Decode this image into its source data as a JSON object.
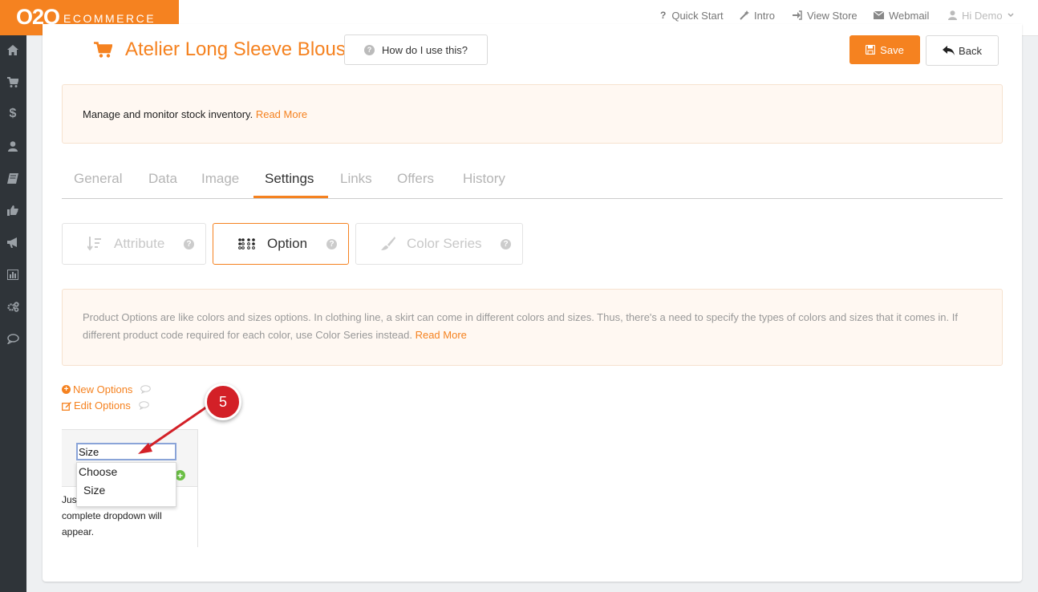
{
  "brand": {
    "o2o": "O2O",
    "ecommerce": "ECOMMERCE",
    "color": "#f58220"
  },
  "topnav": {
    "quick_start": "Quick Start",
    "intro": "Intro",
    "view_store": "View Store",
    "webmail": "Webmail",
    "user": "Hi Demo"
  },
  "sidebar": {
    "items": [
      "home-icon",
      "cart-icon",
      "dollar-icon",
      "user-icon",
      "book-icon",
      "thumbs-up-icon",
      "bullhorn-icon",
      "bar-chart-icon",
      "gears-icon",
      "comment-icon"
    ]
  },
  "header": {
    "title": "Atelier Long Sleeve Blouse",
    "help": "How do I use this?",
    "save": "Save",
    "back": "Back"
  },
  "info": {
    "text": "Manage and monitor stock inventory.",
    "link": "Read More"
  },
  "tabs": [
    "General",
    "Data",
    "Image",
    "Settings",
    "Links",
    "Offers",
    "History"
  ],
  "active_tab": "Settings",
  "subtabs": {
    "attribute": "Attribute",
    "option": "Option",
    "color_series": "Color Series",
    "active": "Option"
  },
  "option_info": {
    "text": "Product Options are like colors and sizes options. In clothing line, a skirt can come in different colors and sizes. Thus, there's a need to specify the types of colors and sizes that it comes in. If different product code required for each color, use Color Series instead.",
    "link": "Read More"
  },
  "options": {
    "new": "New Options",
    "edit": "Edit Options",
    "input_value": "Size",
    "dropdown_header": "Choose",
    "dropdown_item": "Size",
    "hint_partial": "Jus",
    "hint_rest": "complete dropdown will appear."
  },
  "annotation": {
    "step": "5",
    "color": "#d32027"
  }
}
